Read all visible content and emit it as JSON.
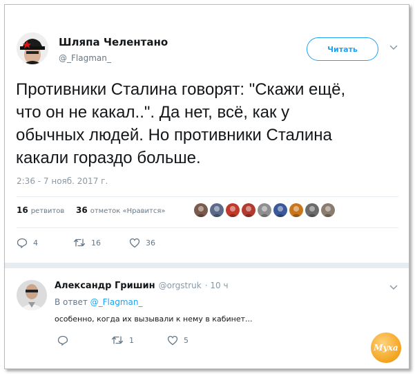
{
  "tweet": {
    "author_name": "Шляпа Челентано",
    "author_handle": "@_Flagman_",
    "follow_label": "Читать",
    "text_lines": [
      "Противники Сталина говорят: \"Скажи ещё,",
      "что он не какал..\". Да нет, всё, как у",
      "обычных людей. Но противники Сталина",
      "какали гораздо больше."
    ],
    "timestamp": "2:36 - 7 нояб. 2017 г.",
    "retweets_count": "16",
    "retweets_label": "ретвитов",
    "likes_count": "36",
    "likes_label": "отметок «Нравится»",
    "actions": {
      "replies": "4",
      "retweets": "16",
      "likes": "36"
    },
    "likers": [
      "#7a5a4a",
      "#5a6a88",
      "#c0392b",
      "#b23a2f",
      "#8f8f8f",
      "#3b5998",
      "#c9761a",
      "#6b6b6b",
      "#8a7c6e"
    ]
  },
  "reply": {
    "author_name": "Александр Гришин",
    "author_handle": "@orgstruk",
    "age": "· 10 ч",
    "reply_to_prefix": "В ответ",
    "reply_to_handle": "@_Flagman_",
    "text": "особенно, когда их вызывали к нему в кабинет...",
    "actions": {
      "replies": "",
      "retweets": "1",
      "likes": "5"
    }
  },
  "watermark_text": "Муха",
  "colors": {
    "accent": "#1da1f2",
    "muted": "#657786",
    "border": "#e6ecf0"
  },
  "icons": [
    "hat-avatar",
    "chevron-down-icon",
    "reply-icon",
    "retweet-icon",
    "heart-icon"
  ]
}
